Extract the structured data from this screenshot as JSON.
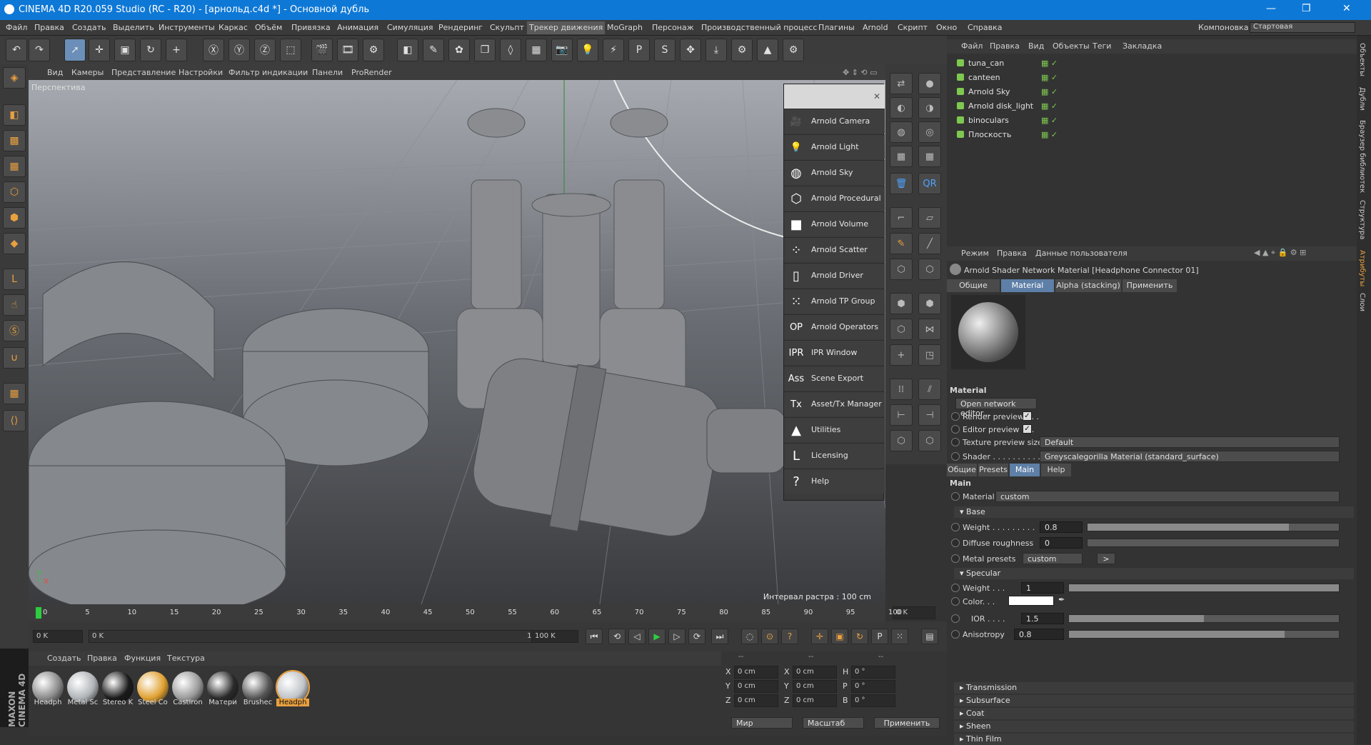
{
  "title": "CINEMA 4D R20.059 Studio (RC - R20) - [арнольд.c4d *] - Основной дубль",
  "window_controls": [
    "—",
    "❐",
    "✕"
  ],
  "menu": [
    "Файл",
    "Правка",
    "Создать",
    "Выделить",
    "Инструменты",
    "Каркас",
    "Объём",
    "Привязка",
    "Анимация",
    "Симуляция",
    "Рендеринг",
    "Скульпт",
    "Трекер движения",
    "MoGraph",
    "Персонаж",
    "Производственный процесс",
    "Плагины",
    "Arnold",
    "Скрипт",
    "Окно",
    "Справка"
  ],
  "layout": {
    "label": "Компоновка",
    "value": "Стартовая"
  },
  "viewport_menu": [
    "Вид",
    "Камеры",
    "Представление",
    "Настройки",
    "Фильтр индикации",
    "Панели",
    "ProRender"
  ],
  "viewport": {
    "label": "Перспектива",
    "grid_info": "Интервал растра : 100 cm"
  },
  "arnold_menu": [
    {
      "icon": "camera-icon",
      "glyph": "🎥",
      "label": "Arnold Camera"
    },
    {
      "icon": "light-bulb-icon",
      "glyph": "💡",
      "label": "Arnold Light"
    },
    {
      "icon": "sky-sphere-icon",
      "glyph": "◍",
      "label": "Arnold Sky"
    },
    {
      "icon": "procedural-cube-icon",
      "glyph": "⬡",
      "label": "Arnold Procedural"
    },
    {
      "icon": "volume-cube-icon",
      "glyph": "■",
      "label": "Arnold Volume"
    },
    {
      "icon": "scatter-dots-icon",
      "glyph": "⁘",
      "label": "Arnold Scatter"
    },
    {
      "icon": "driver-page-icon",
      "glyph": "▯",
      "label": "Arnold Driver"
    },
    {
      "icon": "tp-group-dots-icon",
      "glyph": "⁙",
      "label": "Arnold TP Group"
    },
    {
      "icon": "op-text-icon",
      "glyph": "OP",
      "label": "Arnold Operators"
    },
    {
      "icon": "ipr-text-icon",
      "glyph": "IPR",
      "label": "IPR Window"
    },
    {
      "icon": "ass-text-icon",
      "glyph": "Ass",
      "label": "Scene Export"
    },
    {
      "icon": "tx-text-icon",
      "glyph": "Tx",
      "label": "Asset/Tx Manager"
    },
    {
      "icon": "arnold-logo-icon",
      "glyph": "▲",
      "label": "Utilities"
    },
    {
      "icon": "license-l-icon",
      "glyph": "L",
      "label": "Licensing"
    },
    {
      "icon": "help-question-icon",
      "glyph": "?",
      "label": "Help"
    }
  ],
  "timeline": {
    "ticks": [
      "0",
      "5",
      "10",
      "15",
      "20",
      "25",
      "30",
      "35",
      "40",
      "45",
      "50",
      "55",
      "60",
      "65",
      "70",
      "75",
      "80",
      "85",
      "90",
      "95",
      "100"
    ],
    "current": "0 K"
  },
  "transport": {
    "start": "0 K",
    "range_start": "0 K",
    "range_end": "100 K",
    "end": "100 K"
  },
  "material_manager": {
    "menu": [
      "Создать",
      "Правка",
      "Функция",
      "Текстура"
    ],
    "materials": [
      {
        "label": "Headph",
        "color": "#8a8a8a"
      },
      {
        "label": "Metal Sc",
        "color": "#b0b4b8"
      },
      {
        "label": "Stereo K",
        "color": "#1a1a1a"
      },
      {
        "label": "Steel Co",
        "color": "#e0a030"
      },
      {
        "label": "CastIron",
        "color": "#9a9a9a"
      },
      {
        "label": "Матери",
        "color": "#2a2a2a"
      },
      {
        "label": "Brushec",
        "color": "#555555"
      },
      {
        "label": "Headph",
        "color": "#c0c4c8",
        "selected": true
      }
    ]
  },
  "coords": {
    "header": [
      "--",
      "--",
      "--"
    ],
    "rows": [
      {
        "a": "X",
        "av": "0 cm",
        "b": "X",
        "bv": "0 cm",
        "c": "H",
        "cv": "0 °"
      },
      {
        "a": "Y",
        "av": "0 cm",
        "b": "Y",
        "bv": "0 cm",
        "c": "P",
        "cv": "0 °"
      },
      {
        "a": "Z",
        "av": "0 cm",
        "b": "Z",
        "bv": "0 cm",
        "c": "B",
        "cv": "0 °"
      }
    ],
    "mode1": "Мир",
    "mode2": "Масштаб",
    "apply": "Применить"
  },
  "object_manager": {
    "menu": [
      "Файл",
      "Правка",
      "Вид",
      "Объекты",
      "Теги",
      "Закладка"
    ],
    "objects": [
      {
        "name": "tuna_can"
      },
      {
        "name": "canteen"
      },
      {
        "name": "Arnold Sky"
      },
      {
        "name": "Arnold disk_light"
      },
      {
        "name": "binoculars"
      },
      {
        "name": "Плоскость"
      }
    ]
  },
  "attributes": {
    "menu": [
      "Режим",
      "Правка",
      "Данные пользователя"
    ],
    "title": "Arnold Shader Network Material [Headphone Connector 01]",
    "tabs": [
      "Общие",
      "Material",
      "Alpha (stacking)",
      "Применить"
    ],
    "section_material": "Material",
    "open_network_editor": "Open network editor...",
    "render_preview": "Render preview . . .",
    "editor_preview": "Editor preview . . .",
    "texture_preview_size": "Texture preview size",
    "texture_preview_value": "Default",
    "shader_label": "Shader . . . . . . . . . .",
    "shader_value": "Greyscalegorilla Material (standard_surface)",
    "subtabs": [
      "Общие",
      "Presets",
      "Main",
      "Help"
    ],
    "section_main": "Main",
    "material_label": "Material",
    "material_value": "custom",
    "base": "Base",
    "base_weight_label": "Weight . . . . . . . . .",
    "base_weight": "0.8",
    "diffuse_roughness_label": "Diffuse roughness",
    "diffuse_roughness": "0",
    "metal_presets_label": "Metal presets",
    "metal_presets_value": "custom",
    "metal_presets_button": ">",
    "specular": "Specular",
    "spec_weight_label": "Weight . . .",
    "spec_weight": "1",
    "color_label": "Color. . .",
    "ior_label": "IOR . . . .",
    "ior": "1.5",
    "anisotropy_label": "Anisotropy",
    "anisotropy": "0.8",
    "collapsed": [
      "Transmission",
      "Subsurface",
      "Coat",
      "Sheen",
      "Thin Film"
    ]
  },
  "right_tabs": [
    "Объекты",
    "Дубли",
    "Браузер библиотек",
    "Структура",
    "Атрибуты",
    "Слои"
  ],
  "brand": "MAXON CINEMA 4D",
  "colors": {
    "accent": "#0e78d6",
    "selected_tab": "#5e7fa7",
    "orange": "#e8a040"
  }
}
